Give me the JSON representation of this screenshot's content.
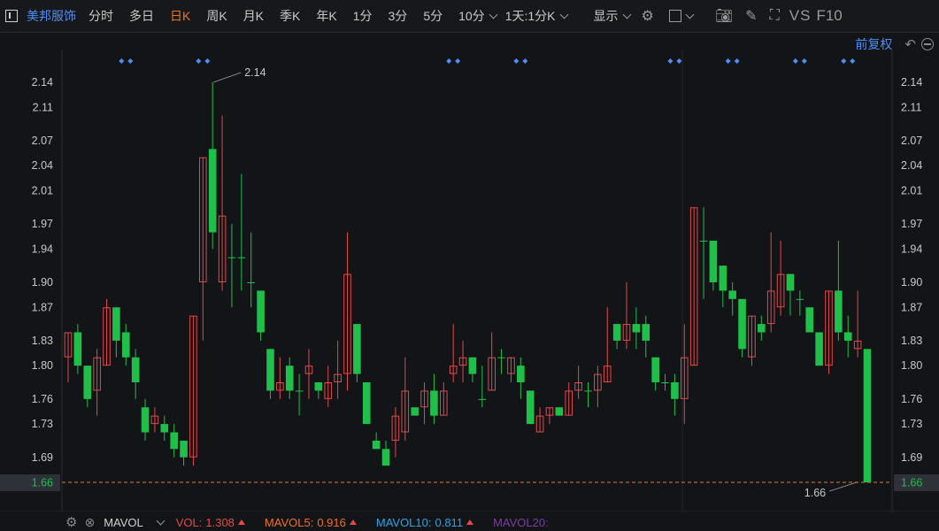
{
  "toolbar": {
    "stock_name": "美邦服饰",
    "periods": [
      "分时",
      "多日",
      "日K",
      "周K",
      "月K",
      "季K",
      "年K",
      "1分",
      "3分",
      "5分",
      "10分"
    ],
    "active_period": "日K",
    "range_label": "1天:1分K",
    "display_label": "显示",
    "vs_label": "VS",
    "f10_label": "F10"
  },
  "subbar": {
    "adjust_label": "前复权"
  },
  "colors": {
    "up": "#e24a4a",
    "down": "#1fbf4a",
    "accent": "#4d8ef7",
    "active": "#f0721e",
    "price_line": "#d9822b"
  },
  "chart_data": {
    "type": "candlestick",
    "y_ticks": [
      "2.14",
      "2.11",
      "2.07",
      "2.04",
      "2.01",
      "1.97",
      "1.94",
      "1.90",
      "1.87",
      "1.83",
      "1.80",
      "1.76",
      "1.73",
      "1.69"
    ],
    "ylim": [
      1.66,
      2.14
    ],
    "last_price_label": "1.66",
    "annotations": [
      {
        "text": "2.14",
        "candle_index": 15,
        "value": 2.14
      },
      {
        "text": "1.66",
        "candle_index": 82,
        "value": 1.66
      }
    ],
    "event_marker_candles": [
      6,
      14,
      40,
      47,
      63,
      69,
      76,
      81
    ],
    "candles": [
      [
        1.81,
        1.84,
        1.78,
        1.84
      ],
      [
        1.84,
        1.8,
        1.79,
        1.85
      ],
      [
        1.8,
        1.76,
        1.75,
        1.8
      ],
      [
        1.77,
        1.81,
        1.74,
        1.82
      ],
      [
        1.8,
        1.87,
        1.8,
        1.88
      ],
      [
        1.87,
        1.83,
        1.81,
        1.87
      ],
      [
        1.84,
        1.81,
        1.8,
        1.85
      ],
      [
        1.81,
        1.78,
        1.76,
        1.82
      ],
      [
        1.75,
        1.72,
        1.71,
        1.76
      ],
      [
        1.73,
        1.74,
        1.72,
        1.75
      ],
      [
        1.73,
        1.72,
        1.71,
        1.74
      ],
      [
        1.72,
        1.7,
        1.69,
        1.73
      ],
      [
        1.71,
        1.69,
        1.68,
        1.71
      ],
      [
        1.69,
        1.86,
        1.68,
        1.86
      ],
      [
        1.9,
        2.05,
        1.83,
        2.05
      ],
      [
        2.06,
        1.96,
        1.94,
        2.14
      ],
      [
        1.9,
        1.98,
        1.89,
        2.1
      ],
      [
        1.93,
        1.93,
        1.87,
        1.97
      ],
      [
        1.93,
        1.93,
        1.89,
        2.03
      ],
      [
        1.9,
        1.9,
        1.87,
        1.96
      ],
      [
        1.89,
        1.84,
        1.83,
        1.89
      ],
      [
        1.82,
        1.77,
        1.76,
        1.82
      ],
      [
        1.77,
        1.78,
        1.76,
        1.81
      ],
      [
        1.8,
        1.77,
        1.76,
        1.81
      ],
      [
        1.77,
        1.77,
        1.74,
        1.79
      ],
      [
        1.79,
        1.8,
        1.76,
        1.82
      ],
      [
        1.78,
        1.77,
        1.76,
        1.78
      ],
      [
        1.76,
        1.78,
        1.75,
        1.8
      ],
      [
        1.78,
        1.79,
        1.76,
        1.83
      ],
      [
        1.79,
        1.91,
        1.77,
        1.96
      ],
      [
        1.85,
        1.79,
        1.78,
        1.85
      ],
      [
        1.78,
        1.73,
        1.73,
        1.78
      ],
      [
        1.71,
        1.7,
        1.7,
        1.72
      ],
      [
        1.7,
        1.68,
        1.68,
        1.71
      ],
      [
        1.71,
        1.74,
        1.69,
        1.75
      ],
      [
        1.72,
        1.77,
        1.71,
        1.81
      ],
      [
        1.75,
        1.74,
        1.74,
        1.75
      ],
      [
        1.75,
        1.77,
        1.73,
        1.78
      ],
      [
        1.77,
        1.74,
        1.73,
        1.79
      ],
      [
        1.74,
        1.77,
        1.74,
        1.78
      ],
      [
        1.79,
        1.8,
        1.78,
        1.85
      ],
      [
        1.8,
        1.81,
        1.78,
        1.83
      ],
      [
        1.81,
        1.79,
        1.78,
        1.81
      ],
      [
        1.76,
        1.76,
        1.75,
        1.8
      ],
      [
        1.77,
        1.81,
        1.77,
        1.84
      ],
      [
        1.81,
        1.81,
        1.79,
        1.82
      ],
      [
        1.79,
        1.81,
        1.78,
        1.81
      ],
      [
        1.8,
        1.78,
        1.76,
        1.81
      ],
      [
        1.77,
        1.73,
        1.73,
        1.77
      ],
      [
        1.72,
        1.74,
        1.72,
        1.75
      ],
      [
        1.74,
        1.75,
        1.73,
        1.75
      ],
      [
        1.75,
        1.74,
        1.74,
        1.75
      ],
      [
        1.74,
        1.77,
        1.74,
        1.78
      ],
      [
        1.77,
        1.78,
        1.76,
        1.8
      ],
      [
        1.77,
        1.77,
        1.75,
        1.78
      ],
      [
        1.77,
        1.79,
        1.75,
        1.8
      ],
      [
        1.78,
        1.8,
        1.78,
        1.87
      ],
      [
        1.85,
        1.83,
        1.82,
        1.85
      ],
      [
        1.83,
        1.85,
        1.82,
        1.9
      ],
      [
        1.85,
        1.84,
        1.82,
        1.87
      ],
      [
        1.85,
        1.83,
        1.81,
        1.86
      ],
      [
        1.81,
        1.78,
        1.77,
        1.81
      ],
      [
        1.78,
        1.78,
        1.77,
        1.79
      ],
      [
        1.78,
        1.76,
        1.74,
        1.79
      ],
      [
        1.76,
        1.81,
        1.73,
        1.85
      ],
      [
        1.8,
        1.99,
        1.8,
        1.99
      ],
      [
        1.95,
        1.95,
        1.88,
        1.99
      ],
      [
        1.95,
        1.9,
        1.89,
        1.95
      ],
      [
        1.92,
        1.89,
        1.87,
        1.92
      ],
      [
        1.89,
        1.88,
        1.86,
        1.9
      ],
      [
        1.88,
        1.82,
        1.81,
        1.88
      ],
      [
        1.81,
        1.86,
        1.8,
        1.86
      ],
      [
        1.85,
        1.84,
        1.83,
        1.86
      ],
      [
        1.85,
        1.89,
        1.84,
        1.96
      ],
      [
        1.87,
        1.91,
        1.86,
        1.95
      ],
      [
        1.91,
        1.89,
        1.86,
        1.91
      ],
      [
        1.88,
        1.88,
        1.86,
        1.89
      ],
      [
        1.87,
        1.84,
        1.84,
        1.87
      ],
      [
        1.84,
        1.8,
        1.8,
        1.84
      ],
      [
        1.8,
        1.89,
        1.79,
        1.89
      ],
      [
        1.89,
        1.84,
        1.83,
        1.95
      ],
      [
        1.84,
        1.83,
        1.81,
        1.86
      ],
      [
        1.82,
        1.83,
        1.81,
        1.89
      ],
      [
        1.82,
        1.66,
        1.66,
        1.82
      ]
    ]
  },
  "volume": {
    "indicator_name": "MAVOL",
    "items": [
      {
        "label": "VOL:",
        "value": "1.308",
        "color": "#e24a4a"
      },
      {
        "label": "MAVOL5:",
        "value": "0.916",
        "color": "#f0721e"
      },
      {
        "label": "MAVOL10:",
        "value": "0.811",
        "color": "#2aa4e8"
      },
      {
        "label": "MAVOL20:",
        "value": "",
        "color": "#7a3fa0"
      }
    ]
  }
}
